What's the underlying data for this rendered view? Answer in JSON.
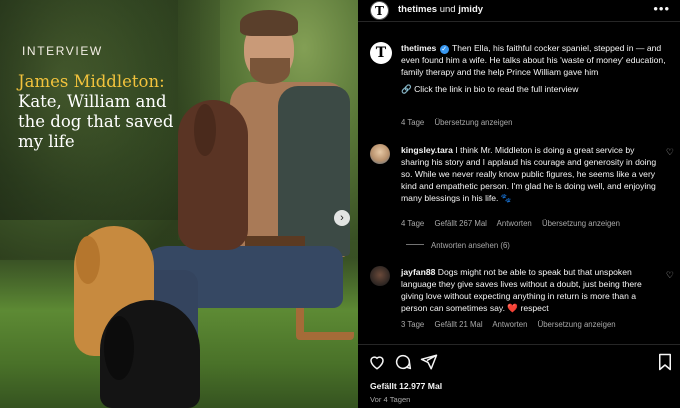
{
  "post_image": {
    "label": "INTERVIEW",
    "title_accent": "James Middleton:",
    "title_rest": "Kate, William and the dog that saved my life",
    "next_icon": "chevron-right-icon"
  },
  "header": {
    "account": "thetimes",
    "joiner": "und",
    "collaborator": "jmidy",
    "more_label": "•••"
  },
  "caption": {
    "username": "thetimes",
    "text": "Then Ella, his faithful cocker spaniel, stepped in — and even found him a wife. He talks about his 'waste of money' education, family therapy and the help Prince William gave him",
    "link_text": "🔗 Click the link in bio to read the full interview",
    "age": "4 Tage",
    "translate": "Übersetzung anzeigen"
  },
  "comments": [
    {
      "username": "kingsley.tara",
      "text": "I think Mr. Middleton is doing a great service by sharing his story and I applaud his courage and generosity in doing so. While we never really know public figures, he seems like a very kind and empathetic person. I'm glad he is doing well, and enjoying many blessings in his life. 🐾",
      "age": "4 Tage",
      "likes": "Gefällt 267 Mal",
      "reply": "Antworten",
      "translate": "Übersetzung anzeigen",
      "view_replies": "Antworten ansehen (6)"
    },
    {
      "username": "jayfan88",
      "text_before": "Dogs might not be able to speak but that unspoken language they give saves lives without a doubt, just being there giving love without expecting anything in return is more than a person can sometimes say.",
      "text_heart": "❤️",
      "text_after": "respect",
      "age": "3 Tage",
      "likes": "Gefällt 21 Mal",
      "reply": "Antworten",
      "translate": "Übersetzung anzeigen"
    }
  ],
  "footer": {
    "likes": "Gefällt 12.977 Mal",
    "posted": "Vor 4 Tagen"
  }
}
